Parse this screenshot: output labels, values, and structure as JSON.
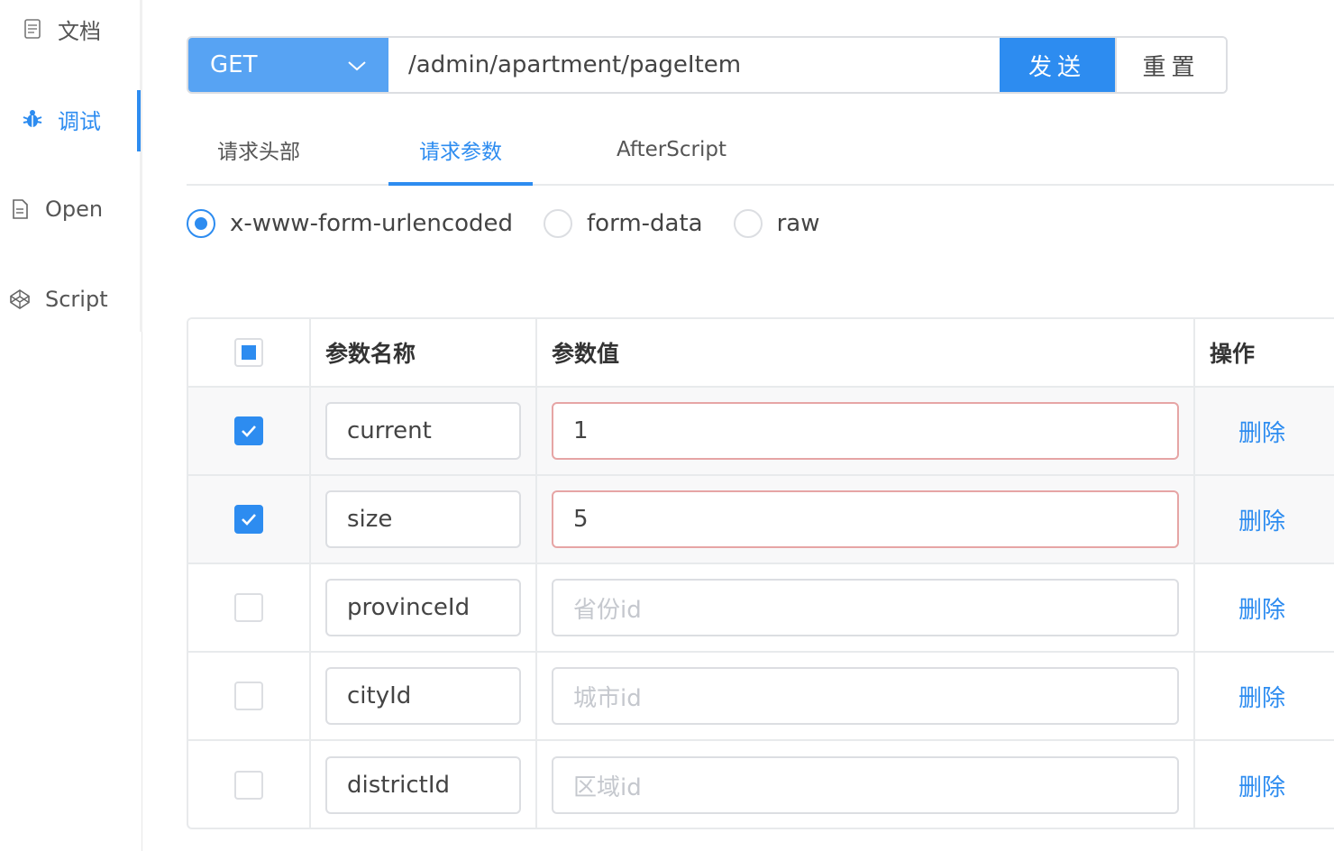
{
  "sidebar": {
    "items": [
      {
        "label": "文档",
        "icon": "document-icon",
        "active": false
      },
      {
        "label": "调试",
        "icon": "bug-icon",
        "active": true
      },
      {
        "label": "Open",
        "icon": "file-icon",
        "active": false
      },
      {
        "label": "Script",
        "icon": "codepen-icon",
        "active": false
      }
    ]
  },
  "request": {
    "method": "GET",
    "url": "/admin/apartment/pageItem",
    "send_label": "发送",
    "reset_label": "重置"
  },
  "tabs": [
    {
      "label": "请求头部",
      "active": false
    },
    {
      "label": "请求参数",
      "active": true
    },
    {
      "label": "AfterScript",
      "active": false
    }
  ],
  "body_types": [
    {
      "label": "x-www-form-urlencoded",
      "checked": true
    },
    {
      "label": "form-data",
      "checked": false
    },
    {
      "label": "raw",
      "checked": false
    }
  ],
  "table": {
    "headers": {
      "name": "参数名称",
      "value": "参数值",
      "op": "操作"
    },
    "rows": [
      {
        "checked": true,
        "name": "current",
        "value": "1",
        "placeholder": "",
        "delete_label": "删除"
      },
      {
        "checked": true,
        "name": "size",
        "value": "5",
        "placeholder": "",
        "delete_label": "删除"
      },
      {
        "checked": false,
        "name": "provinceId",
        "value": "",
        "placeholder": "省份id",
        "delete_label": "删除"
      },
      {
        "checked": false,
        "name": "cityId",
        "value": "",
        "placeholder": "城市id",
        "delete_label": "删除"
      },
      {
        "checked": false,
        "name": "districtId",
        "value": "",
        "placeholder": "区域id",
        "delete_label": "删除"
      }
    ]
  },
  "colors": {
    "accent": "#2d8cf0",
    "method_bg": "#57a3f3",
    "error_border": "#e6a5a5"
  }
}
